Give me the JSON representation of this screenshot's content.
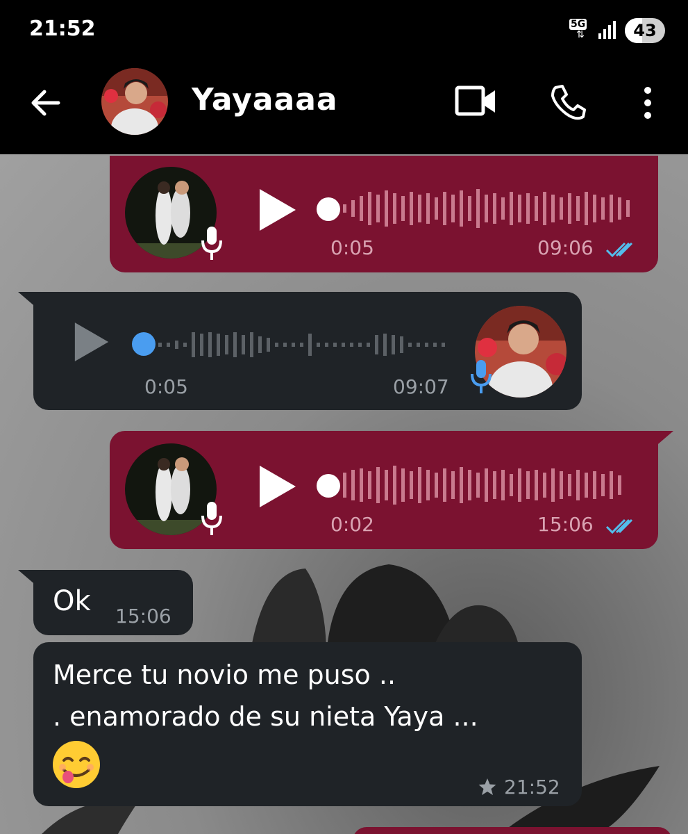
{
  "status_bar": {
    "time": "21:52",
    "network": "5G",
    "battery": "43"
  },
  "header": {
    "contact_name": "Yayaaaa"
  },
  "messages": [
    {
      "type": "voice",
      "direction": "outgoing",
      "duration": "0:05",
      "time": "09:06",
      "read": true
    },
    {
      "type": "voice",
      "direction": "incoming",
      "duration": "0:05",
      "time": "09:07"
    },
    {
      "type": "voice",
      "direction": "outgoing",
      "duration": "0:02",
      "time": "15:06",
      "read": true
    },
    {
      "type": "text",
      "direction": "incoming",
      "text": "Ok",
      "time": "15:06"
    },
    {
      "type": "text",
      "direction": "incoming",
      "line1": "Merce tu novio me puso ..",
      "line2": ". enamorado de su nieta  Yaya ...",
      "emoji": "smiling-face-tongue",
      "time": "21:52",
      "starred": true
    }
  ],
  "colors": {
    "outgoing_bubble": "#7b1230",
    "incoming_bubble": "#1f2327",
    "read_ticks": "#53bdeb",
    "incoming_play_dot": "#4a9df0"
  }
}
